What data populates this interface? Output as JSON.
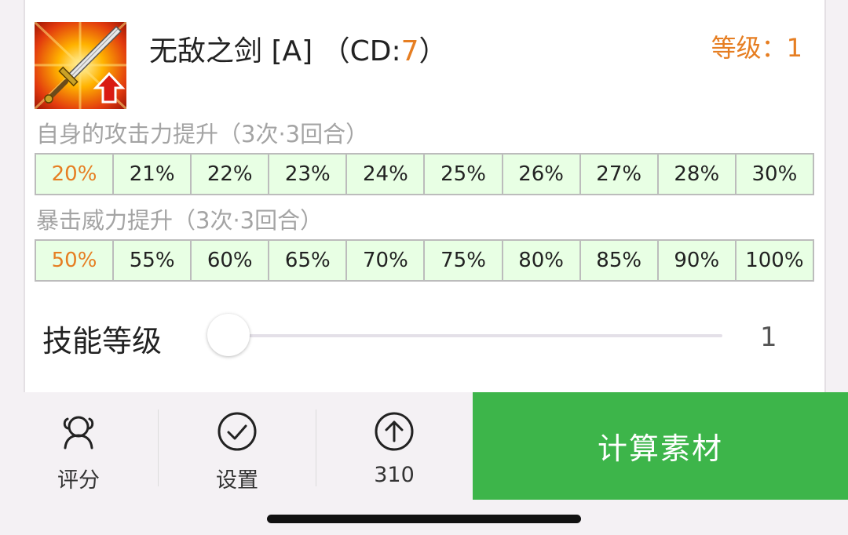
{
  "skill": {
    "name": "无敌之剑 [A]",
    "cd_prefix": "（CD:",
    "cd_value": "7",
    "cd_suffix": "）",
    "level_label": "等级：1",
    "icon": "sword-up-arrow-icon"
  },
  "effects": [
    {
      "label": "自身的攻击力提升（3次·3回合）",
      "values": [
        "20%",
        "21%",
        "22%",
        "23%",
        "24%",
        "25%",
        "26%",
        "27%",
        "28%",
        "30%"
      ],
      "active_index": 0
    },
    {
      "label": "暴击威力提升（3次·3回合）",
      "values": [
        "50%",
        "55%",
        "60%",
        "65%",
        "70%",
        "75%",
        "80%",
        "85%",
        "90%",
        "100%"
      ],
      "active_index": 0
    }
  ],
  "slider": {
    "label": "技能等级",
    "value": "1",
    "min": 1,
    "max": 10
  },
  "bottom_nav": [
    {
      "label": "评分",
      "icon": "user-rating-icon"
    },
    {
      "label": "设置",
      "icon": "check-circle-icon"
    },
    {
      "label": "310",
      "icon": "arrow-up-circle-icon"
    }
  ],
  "calc_button": {
    "label": "计算素材"
  },
  "colors": {
    "accent_orange": "#e67e22",
    "button_green": "#3db54a",
    "table_bg": "#e8ffe4"
  }
}
